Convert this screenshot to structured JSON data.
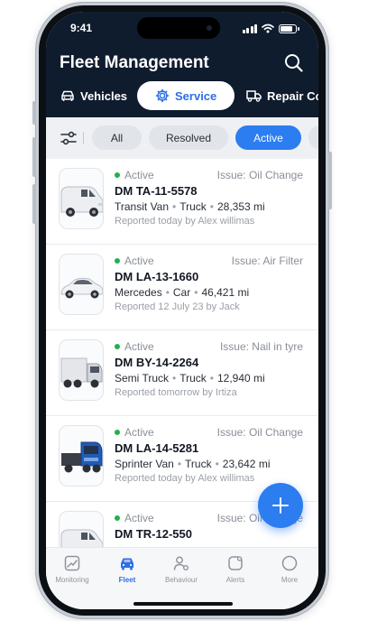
{
  "status_bar": {
    "time": "9:41"
  },
  "header": {
    "title": "Fleet Management",
    "search_icon": "search-icon"
  },
  "tabs": [
    {
      "label": "Vehicles",
      "icon": "car-icon",
      "active": false
    },
    {
      "label": "Service",
      "icon": "gear-icon",
      "active": true
    },
    {
      "label": "Repair Cos",
      "icon": "truck-icon",
      "active": false
    }
  ],
  "filters": {
    "icon": "filter-sliders-icon",
    "chips": [
      {
        "label": "All",
        "active": false
      },
      {
        "label": "Resolved",
        "active": false
      },
      {
        "label": "Active",
        "active": true
      }
    ]
  },
  "services": [
    {
      "status": "Active",
      "issue": "Issue: Oil Change",
      "plate": "DM TA-11-5578",
      "model": "Transit Van",
      "type": "Truck",
      "mileage": "28,353 mi",
      "reported": "Reported today by Alex willimas",
      "image": "van-image"
    },
    {
      "status": "Active",
      "issue": "Issue: Air Filter",
      "plate": "DM LA-13-1660",
      "model": "Mercedes",
      "type": "Car",
      "mileage": "46,421 mi",
      "reported": "Reported 12 July 23 by Jack",
      "image": "car-image"
    },
    {
      "status": "Active",
      "issue": "Issue: Nail in tyre",
      "plate": "DM BY-14-2264",
      "model": "Semi Truck",
      "type": "Truck",
      "mileage": "12,940 mi",
      "reported": "Reported tomorrow by Irtiza",
      "image": "semi-truck-image"
    },
    {
      "status": "Active",
      "issue": "Issue: Oil Change",
      "plate": "DM LA-14-5281",
      "model": "Sprinter Van",
      "type": "Truck",
      "mileage": "23,642 mi",
      "reported": "Reported today by Alex willimas",
      "image": "blue-truck-image"
    },
    {
      "status": "Active",
      "issue": "Issue: Oil Change",
      "plate": "DM TR-12-550",
      "model": "",
      "type": "",
      "mileage": "",
      "reported": "",
      "image": "van-image"
    }
  ],
  "fab": {
    "icon": "plus-icon"
  },
  "bottom_nav": [
    {
      "label": "Monitoring",
      "icon": "monitoring-icon",
      "active": false
    },
    {
      "label": "Fleet",
      "icon": "car-icon",
      "active": true
    },
    {
      "label": "Behaviour",
      "icon": "user-behaviour-icon",
      "active": false
    },
    {
      "label": "Alerts",
      "icon": "alert-icon",
      "active": false
    },
    {
      "label": "More",
      "icon": "more-icon",
      "active": false
    }
  ],
  "colors": {
    "header_bg": "#0f1c2e",
    "accent": "#2c7df0",
    "active_status": "#22b14c"
  }
}
